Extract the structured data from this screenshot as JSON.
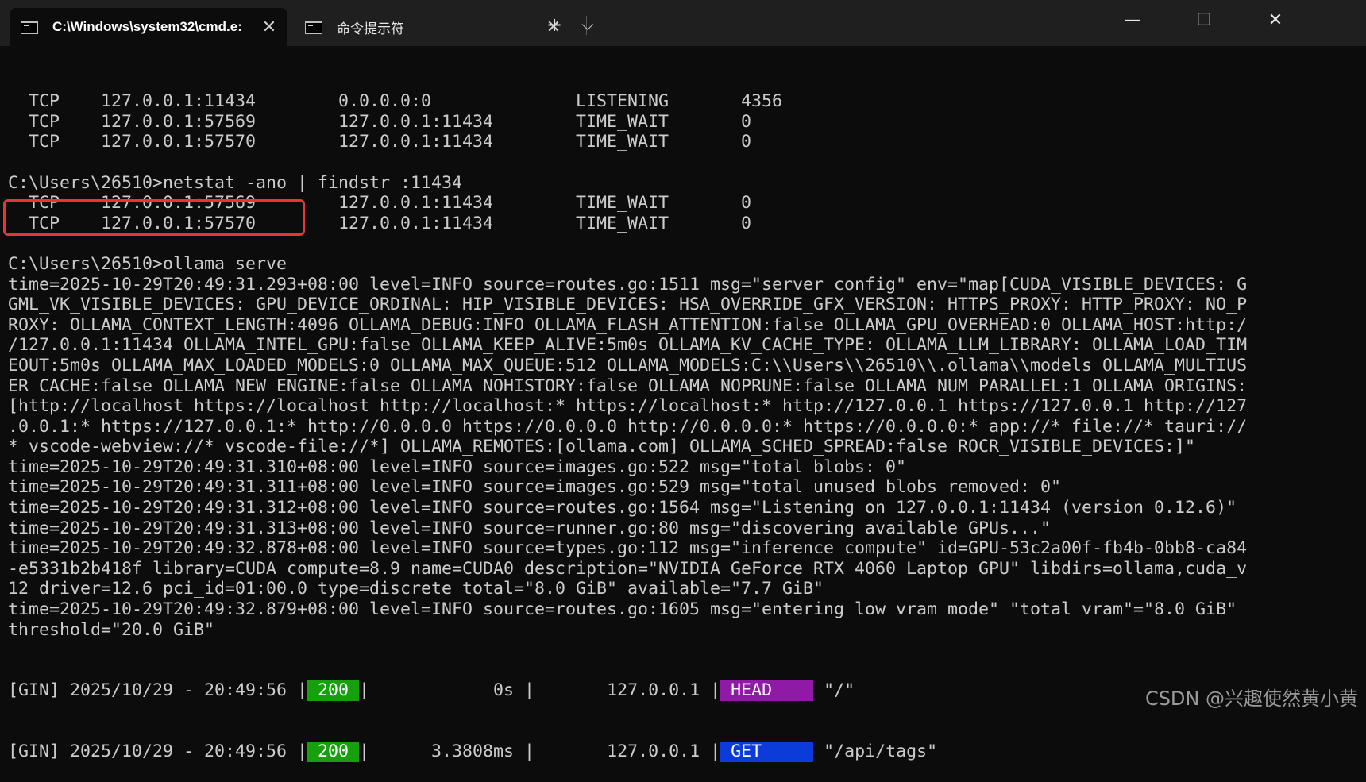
{
  "window": {
    "tabs": [
      {
        "title": "C:\\Windows\\system32\\cmd.e:",
        "close": "✕",
        "icon": "terminal-icon"
      },
      {
        "title": "命令提示符",
        "close": "✕",
        "icon": "terminal-icon"
      }
    ],
    "new_tab": "+",
    "dropdown": "⌵",
    "minimize": "—",
    "maximize": "☐",
    "close": "✕"
  },
  "console": {
    "lines": [
      "  TCP    127.0.0.1:11434        0.0.0.0:0              LISTENING       4356",
      "  TCP    127.0.0.1:57569        127.0.0.1:11434        TIME_WAIT       0",
      "  TCP    127.0.0.1:57570        127.0.0.1:11434        TIME_WAIT       0",
      "",
      "C:\\Users\\26510>netstat -ano | findstr :11434",
      "  TCP    127.0.0.1:57569        127.0.0.1:11434        TIME_WAIT       0",
      "  TCP    127.0.0.1:57570        127.0.0.1:11434        TIME_WAIT       0",
      "",
      "C:\\Users\\26510>ollama serve",
      "time=2025-10-29T20:49:31.293+08:00 level=INFO source=routes.go:1511 msg=\"server config\" env=\"map[CUDA_VISIBLE_DEVICES: G",
      "GML_VK_VISIBLE_DEVICES: GPU_DEVICE_ORDINAL: HIP_VISIBLE_DEVICES: HSA_OVERRIDE_GFX_VERSION: HTTPS_PROXY: HTTP_PROXY: NO_P",
      "ROXY: OLLAMA_CONTEXT_LENGTH:4096 OLLAMA_DEBUG:INFO OLLAMA_FLASH_ATTENTION:false OLLAMA_GPU_OVERHEAD:0 OLLAMA_HOST:http:/",
      "/127.0.0.1:11434 OLLAMA_INTEL_GPU:false OLLAMA_KEEP_ALIVE:5m0s OLLAMA_KV_CACHE_TYPE: OLLAMA_LLM_LIBRARY: OLLAMA_LOAD_TIM",
      "EOUT:5m0s OLLAMA_MAX_LOADED_MODELS:0 OLLAMA_MAX_QUEUE:512 OLLAMA_MODELS:C:\\\\Users\\\\26510\\\\.ollama\\\\models OLLAMA_MULTIUS",
      "ER_CACHE:false OLLAMA_NEW_ENGINE:false OLLAMA_NOHISTORY:false OLLAMA_NOPRUNE:false OLLAMA_NUM_PARALLEL:1 OLLAMA_ORIGINS:",
      "[http://localhost https://localhost http://localhost:* https://localhost:* http://127.0.0.1 https://127.0.0.1 http://127",
      ".0.0.1:* https://127.0.0.1:* http://0.0.0.0 https://0.0.0.0 http://0.0.0.0:* https://0.0.0.0:* app://* file://* tauri://",
      "* vscode-webview://* vscode-file://*] OLLAMA_REMOTES:[ollama.com] OLLAMA_SCHED_SPREAD:false ROCR_VISIBLE_DEVICES:]\"",
      "time=2025-10-29T20:49:31.310+08:00 level=INFO source=images.go:522 msg=\"total blobs: 0\"",
      "time=2025-10-29T20:49:31.311+08:00 level=INFO source=images.go:529 msg=\"total unused blobs removed: 0\"",
      "time=2025-10-29T20:49:31.312+08:00 level=INFO source=routes.go:1564 msg=\"Listening on 127.0.0.1:11434 (version 0.12.6)\"",
      "time=2025-10-29T20:49:31.313+08:00 level=INFO source=runner.go:80 msg=\"discovering available GPUs...\"",
      "time=2025-10-29T20:49:32.878+08:00 level=INFO source=types.go:112 msg=\"inference compute\" id=GPU-53c2a00f-fb4b-0bb8-ca84",
      "-e5331b2b418f library=CUDA compute=8.9 name=CUDA0 description=\"NVIDIA GeForce RTX 4060 Laptop GPU\" libdirs=ollama,cuda_v",
      "12 driver=12.6 pci_id=01:00.0 type=discrete total=\"8.0 GiB\" available=\"7.7 GiB\"",
      "time=2025-10-29T20:49:32.879+08:00 level=INFO source=routes.go:1605 msg=\"entering low vram mode\" \"total vram\"=\"8.0 GiB\"",
      "threshold=\"20.0 GiB\""
    ],
    "gin": [
      {
        "prefix": "[GIN] 2025/10/29 - 20:49:56 |",
        "status": " 200 ",
        "sep1": "|",
        "latency": "            0s |",
        "client": "       127.0.0.1 |",
        "method": " HEAD    ",
        "path": " \"/\""
      },
      {
        "prefix": "[GIN] 2025/10/29 - 20:49:56 |",
        "status": " 200 ",
        "sep1": "|",
        "latency": "      3.3808ms |",
        "client": "       127.0.0.1 |",
        "method": " GET     ",
        "path": " \"/api/tags\""
      }
    ]
  },
  "watermark": "CSDN @兴趣使然黄小黄",
  "colors": {
    "status_ok": "#16a00d",
    "head": "#8e1aa6",
    "get": "#0b3bd9",
    "highlight": "#e8333b"
  }
}
